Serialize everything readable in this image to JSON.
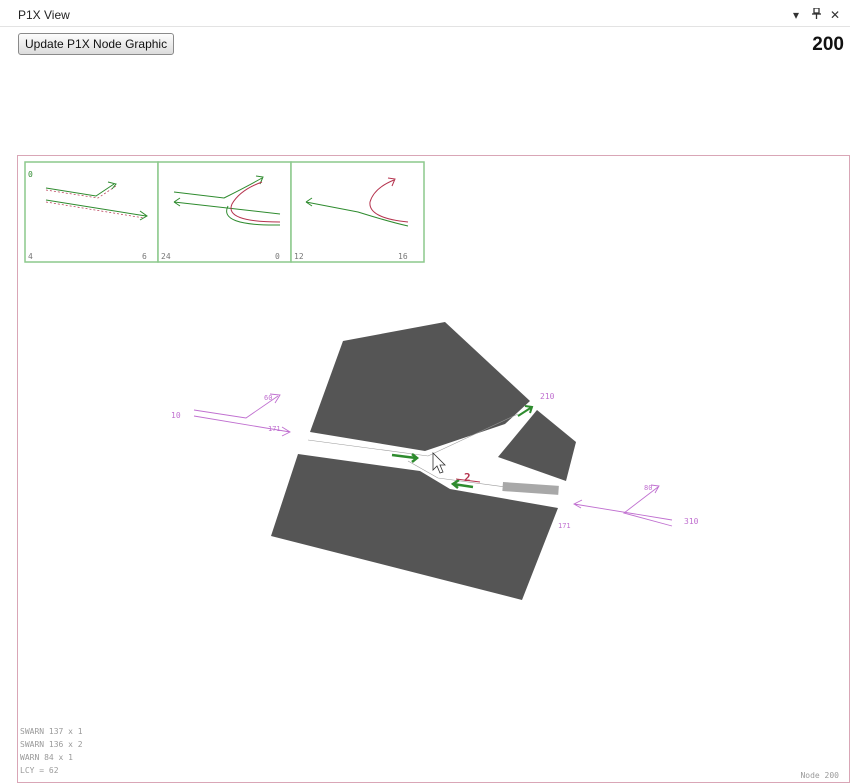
{
  "panel": {
    "title": "P1X View",
    "dropdown_glyph": "▾",
    "pin_glyph": "ᵖ",
    "close_glyph": "✕"
  },
  "toolbar": {
    "update_label": "Update P1X Node Graphic"
  },
  "node_number": "200",
  "phases": [
    {
      "top_left": "0",
      "bottom_left": "4",
      "bottom_right": "6"
    },
    {
      "top_left": "",
      "bottom_left": "24",
      "bottom_right": "0"
    },
    {
      "top_left": "",
      "bottom_left": "12",
      "bottom_right": "16"
    }
  ],
  "approaches": [
    {
      "id": "10",
      "vol_a": "60",
      "vol_b": "171"
    },
    {
      "id": "210",
      "vol_a": "",
      "vol_b": ""
    },
    {
      "id": "310",
      "vol_a": "80",
      "vol_b": "171"
    }
  ],
  "signal_marker": "2",
  "warnings": [
    {
      "text": "SWARN 137 x  1"
    },
    {
      "text": "SWARN 136 x  2"
    },
    {
      "text": "WARN   84 x  1"
    },
    {
      "text": "LCY =  62"
    }
  ],
  "node_label": "Node 200",
  "colors": {
    "road": "#555555",
    "phase_green": "#2e8b2e",
    "conflict_red": "#b5334e",
    "volume_violet": "#c070d0",
    "border_pink": "#d9a6b6"
  }
}
